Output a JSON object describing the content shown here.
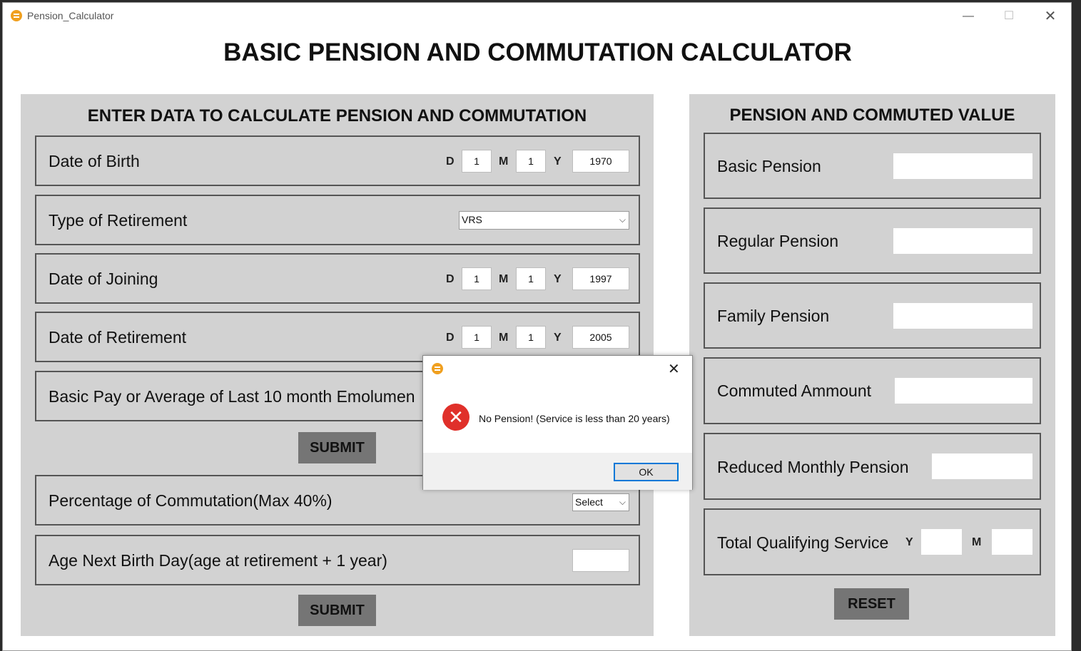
{
  "window": {
    "title": "Pension_Calculator",
    "minimize": "—",
    "maximize": "☐",
    "close": "✕"
  },
  "main_title": "BASIC PENSION AND COMMUTATION CALCULATOR",
  "left": {
    "heading": "ENTER DATA TO CALCULATE PENSION AND COMMUTATION",
    "dob": {
      "label": "Date of Birth",
      "d_label": "D",
      "m_label": "M",
      "y_label": "Y",
      "d": "1",
      "m": "1",
      "y": "1970"
    },
    "retirement_type": {
      "label": "Type of Retirement",
      "value": "VRS"
    },
    "doj": {
      "label": "Date of Joining",
      "d_label": "D",
      "m_label": "M",
      "y_label": "Y",
      "d": "1",
      "m": "1",
      "y": "1997"
    },
    "dor": {
      "label": "Date of Retirement",
      "d_label": "D",
      "m_label": "M",
      "y_label": "Y",
      "d": "1",
      "m": "1",
      "y": "2005"
    },
    "basic_pay": {
      "label": "Basic Pay or Average of Last 10 month Emolumen"
    },
    "submit1": "SUBMIT",
    "commutation_pct": {
      "label": "Percentage of Commutation(Max 40%)",
      "value": "Select"
    },
    "age_next": {
      "label": "Age Next Birth Day(age at retirement + 1 year)",
      "value": ""
    },
    "submit2": "SUBMIT"
  },
  "right": {
    "heading": "PENSION AND COMMUTED VALUE",
    "basic_pension": "Basic Pension",
    "regular_pension": "Regular Pension",
    "family_pension": "Family Pension",
    "commuted_amount": "Commuted Ammount",
    "reduced_pension": "Reduced Monthly Pension",
    "qualifying_service": {
      "label": "Total Qualifying Service",
      "y_label": "Y",
      "m_label": "M"
    },
    "reset": "RESET"
  },
  "dialog": {
    "close": "✕",
    "error_glyph": "✕",
    "message": "No Pension! (Service is less than 20 years)",
    "ok": "OK"
  }
}
